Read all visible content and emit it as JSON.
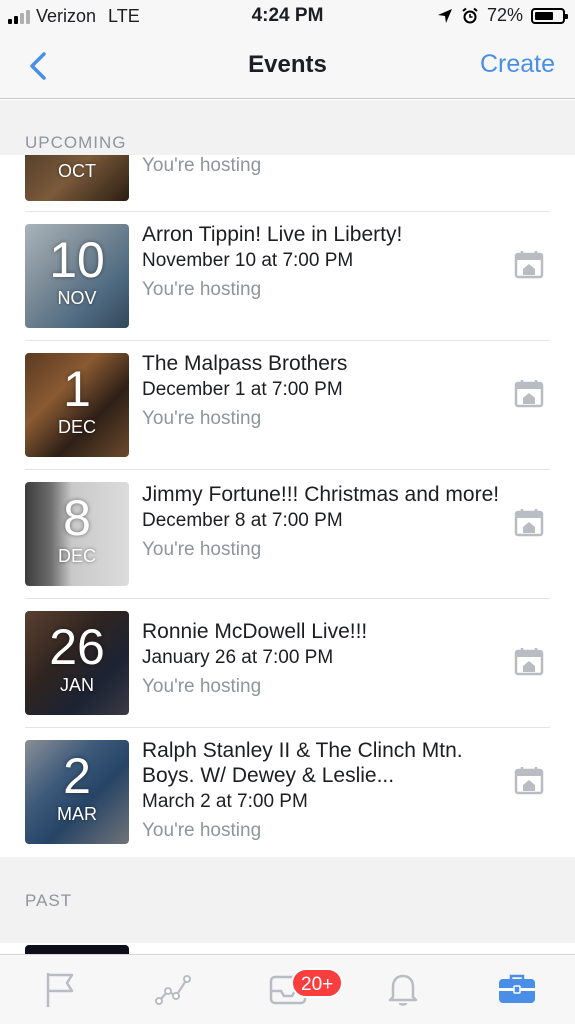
{
  "status_bar": {
    "carrier": "Verizon",
    "network": "LTE",
    "time": "4:24 PM",
    "battery": "72%",
    "battery_level": 0.72
  },
  "nav": {
    "back_icon": "chevron-left-icon",
    "title": "Events",
    "create_label": "Create"
  },
  "sections": {
    "upcoming_label": "UPCOMING",
    "past_label": "PAST"
  },
  "events": [
    {
      "day": "",
      "month": "OCT",
      "title": "",
      "date": "",
      "host": "You're hosting"
    },
    {
      "day": "10",
      "month": "NOV",
      "title": "Arron Tippin! Live in Liberty!",
      "date": "November 10 at 7:00 PM",
      "host": "You're hosting"
    },
    {
      "day": "1",
      "month": "DEC",
      "title": "The Malpass Brothers",
      "date": "December 1 at 7:00 PM",
      "host": "You're hosting"
    },
    {
      "day": "8",
      "month": "DEC",
      "title": "Jimmy Fortune!!! Christmas and more!",
      "date": "December 8 at 7:00 PM",
      "host": "You're hosting"
    },
    {
      "day": "26",
      "month": "JAN",
      "title": "Ronnie McDowell Live!!!",
      "date": "January 26 at 7:00 PM",
      "host": "You're hosting"
    },
    {
      "day": "2",
      "month": "MAR",
      "title": "Ralph Stanley II & The Clinch Mtn. Boys. W/ Dewey & Leslie...",
      "date": "March 2 at 7:00 PM",
      "host": "You're hosting"
    }
  ],
  "tab_bar": {
    "tabs": [
      "flag-icon",
      "insights-icon",
      "inbox-icon",
      "bell-icon",
      "briefcase-icon"
    ],
    "inbox_badge": "20+"
  },
  "colors": {
    "accent": "#4a8fe7",
    "badge": "#fa3e3e",
    "secondary_text": "#90949c"
  }
}
